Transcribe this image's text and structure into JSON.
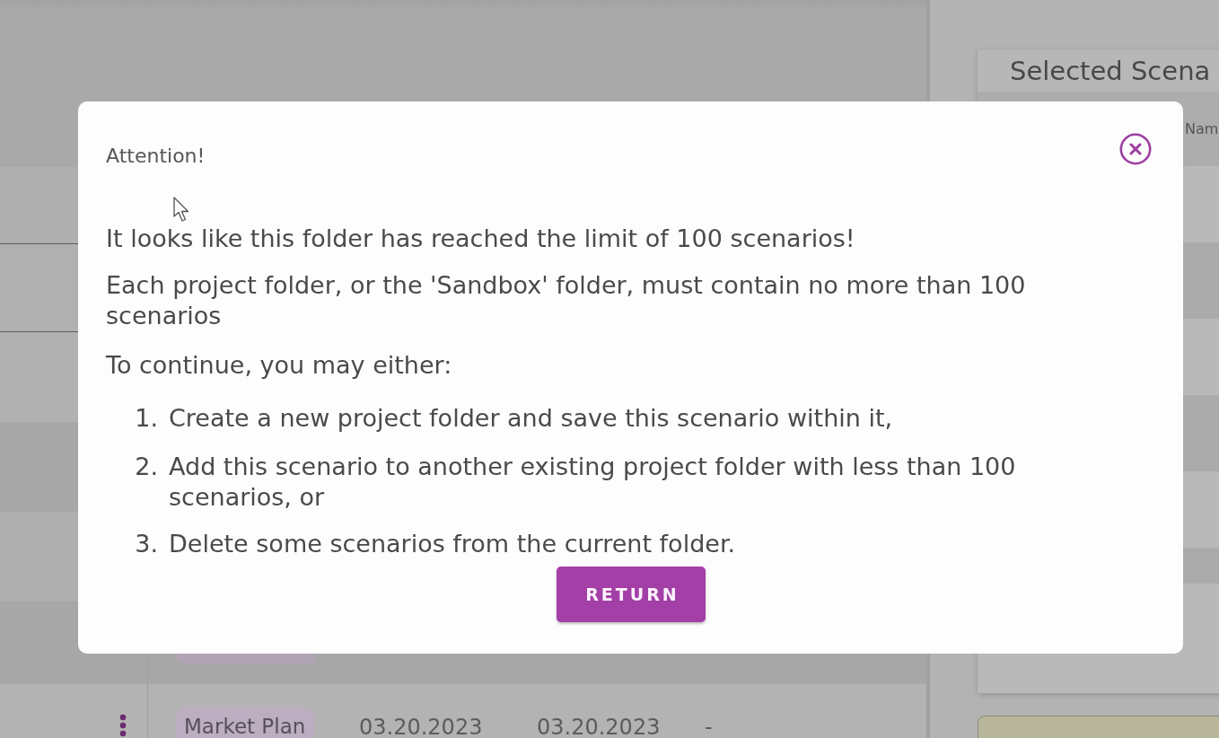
{
  "scenario_table": {
    "rows": [
      {
        "tag": "Market Plan",
        "cells": [
          "03.20.2023",
          "03.20.2023",
          "-"
        ]
      }
    ]
  },
  "selected_panel": {
    "title": "Selected Scena",
    "columns": [
      "Nam"
    ]
  },
  "dialog": {
    "title": "Attention!",
    "paragraphs": [
      "It looks like this folder has reached the limit of 100 scenarios!",
      "Each project folder, or the 'Sandbox' folder, must contain no more than 100 scenarios",
      "To continue, you may either:"
    ],
    "steps": [
      {
        "number": "1.",
        "text": "Create a new project folder and save this scenario within it,"
      },
      {
        "number": "2.",
        "text": "Add this scenario to another existing project folder with less than 100 scenarios, or"
      },
      {
        "number": "3.",
        "text": "Delete some scenarios from the current folder."
      }
    ],
    "button": "RETURN"
  }
}
